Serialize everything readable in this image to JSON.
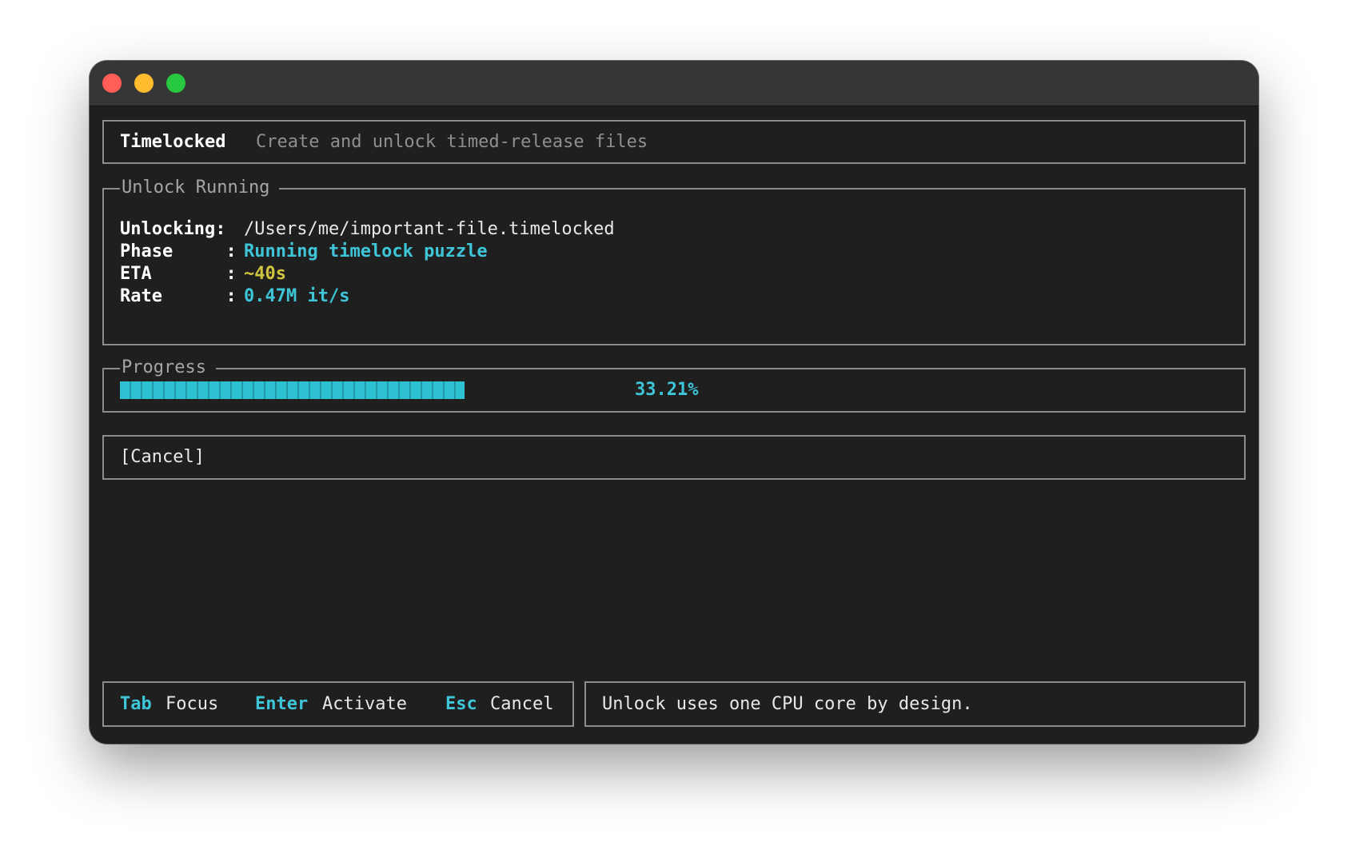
{
  "header": {
    "app_name": "Timelocked",
    "tagline": "Create and unlock timed-release files"
  },
  "unlock_panel": {
    "title": "Unlock Running",
    "rows": [
      {
        "label": "Unlocking:",
        "value": "/Users/me/important-file.timelocked",
        "color": "#e8e8e8"
      },
      {
        "label": "Phase     :",
        "value": "Running timelock puzzle",
        "color": "#3ec6d8"
      },
      {
        "label": "ETA       :",
        "value": "~40s",
        "color": "#cfc43f"
      },
      {
        "label": "Rate      :",
        "value": "0.47M it/s",
        "color": "#3ec6d8"
      }
    ]
  },
  "progress": {
    "title": "Progress",
    "fraction": 0.3321,
    "percent_label": "33.21%"
  },
  "actions": {
    "cancel_label": "[Cancel]"
  },
  "footer": {
    "keys": [
      {
        "key": "Tab",
        "action": "Focus"
      },
      {
        "key": "Enter",
        "action": "Activate"
      },
      {
        "key": "Esc",
        "action": "Cancel"
      }
    ],
    "hint": "Unlock uses one CPU core by design."
  },
  "colors": {
    "accent": "#3ec6d8",
    "eta": "#cfc43f",
    "border": "#8c8c8c",
    "background": "#1f1f1f"
  }
}
